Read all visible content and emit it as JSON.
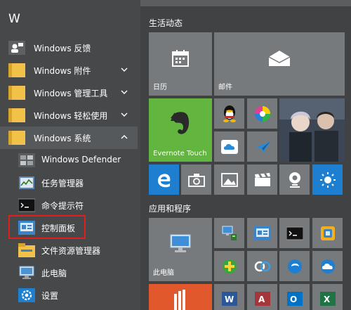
{
  "section_letter": "W",
  "app_list": [
    {
      "label": "Windows 反馈",
      "icon": "feedback-icon"
    },
    {
      "label": "Windows 附件",
      "icon": "folder-icon",
      "expandable": true
    },
    {
      "label": "Windows 管理工具",
      "icon": "folder-icon",
      "expandable": true
    },
    {
      "label": "Windows 轻松使用",
      "icon": "folder-icon",
      "expandable": true
    },
    {
      "label": "Windows 系统",
      "icon": "folder-icon",
      "expandable": true,
      "expanded": true
    },
    {
      "label": "Windows Defender",
      "icon": "defender-icon"
    },
    {
      "label": "任务管理器",
      "icon": "task-manager-icon"
    },
    {
      "label": "命令提示符",
      "icon": "cmd-icon"
    },
    {
      "label": "控制面板",
      "icon": "control-panel-icon",
      "highlighted": true
    },
    {
      "label": "文件资源管理器",
      "icon": "file-explorer-icon"
    },
    {
      "label": "此电脑",
      "icon": "this-pc-icon"
    },
    {
      "label": "设置",
      "icon": "settings-icon"
    }
  ],
  "groups": {
    "life": "生活动态",
    "apps": "应用和程序"
  },
  "tiles": {
    "calendar": "日历",
    "mail": "邮件",
    "evernote": "Evernote Touch",
    "this_pc": "此电脑"
  },
  "colors": {
    "highlight_border": "#e01e1e",
    "accent_blue": "#1e7fd0",
    "evernote_green": "#62b640",
    "folder_yellow": "#f2c14a"
  }
}
